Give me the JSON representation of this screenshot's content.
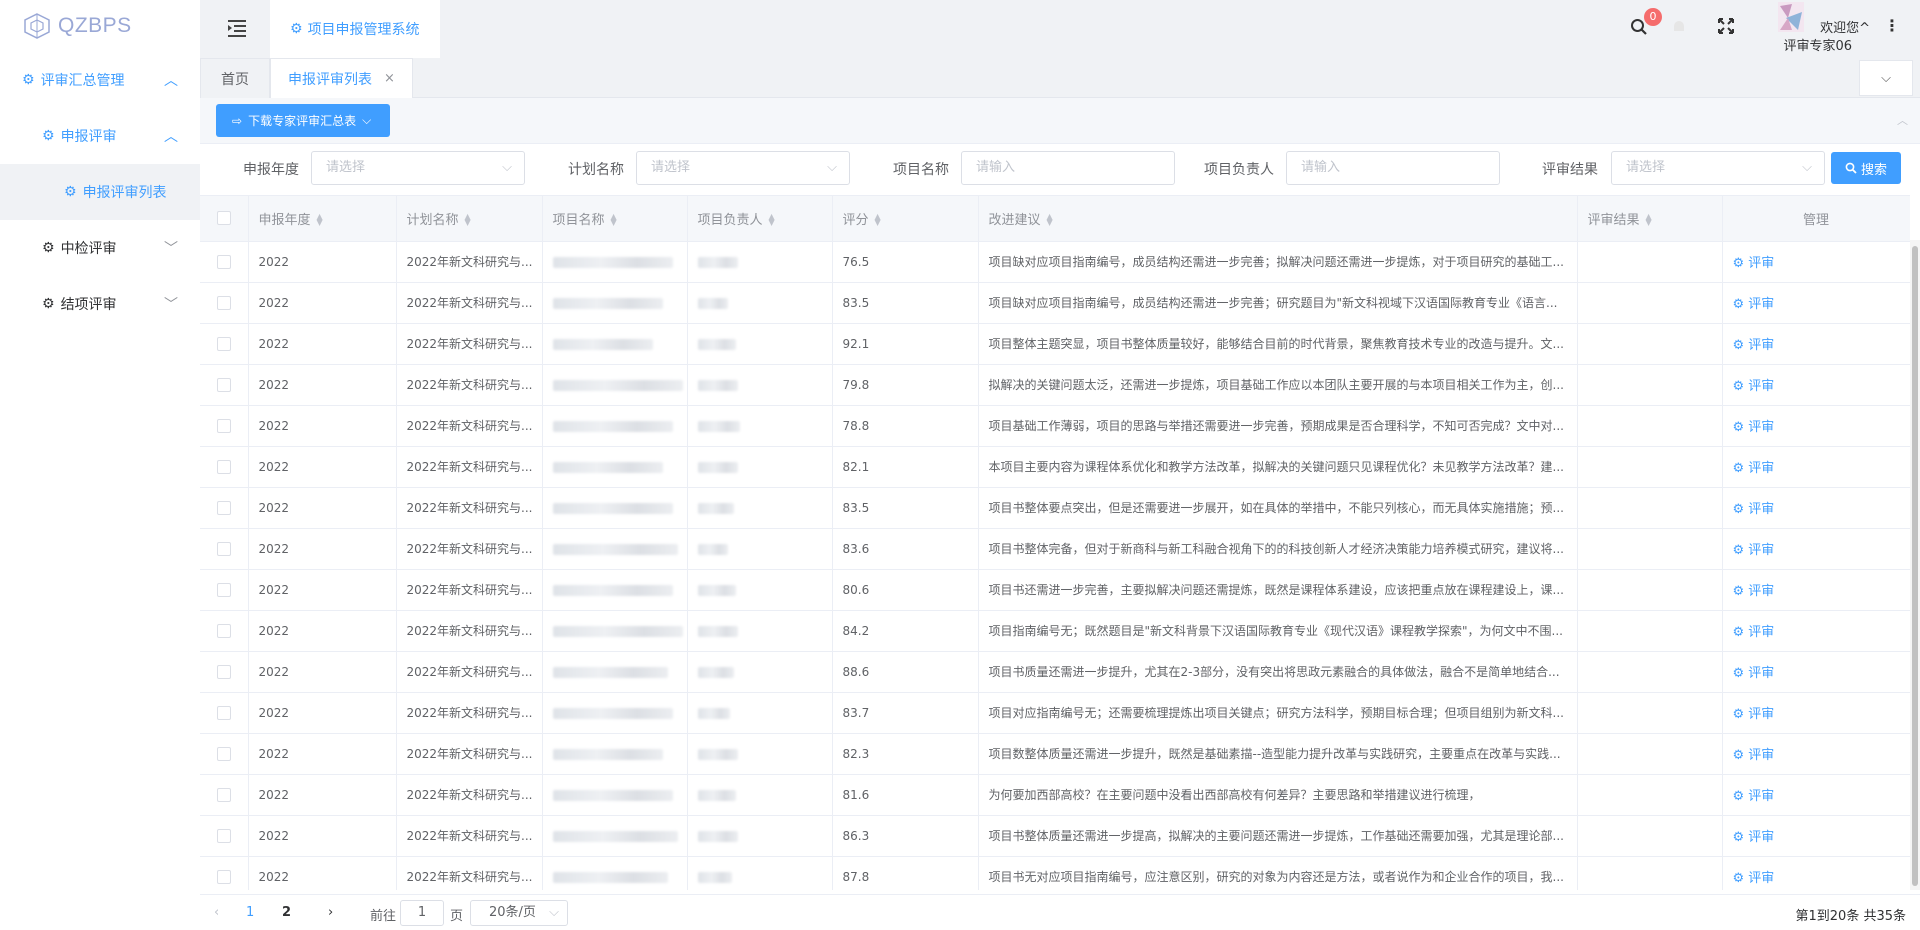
{
  "app": {
    "logo": "QZBPS",
    "system_tab": "项目申报管理系统"
  },
  "header": {
    "notification_count": "0",
    "welcome": "欢迎您^",
    "user_name": "评审专家06"
  },
  "sidebar": {
    "items": [
      {
        "label": "评审汇总管理",
        "level": 1
      },
      {
        "label": "申报评审",
        "level": 2
      },
      {
        "label": "申报评审列表",
        "level": 3
      },
      {
        "label": "中检评审",
        "level": 2
      },
      {
        "label": "结项评审",
        "level": 2
      }
    ]
  },
  "tabs": {
    "home": "首页",
    "active": "申报评审列表",
    "close": "×"
  },
  "toolbar": {
    "download_label": "下载专家评审汇总表"
  },
  "filters": {
    "year_label": "申报年度",
    "year_placeholder": "请选择",
    "plan_label": "计划名称",
    "plan_placeholder": "请选择",
    "project_label": "项目名称",
    "project_placeholder": "请输入",
    "leader_label": "项目负责人",
    "leader_placeholder": "请输入",
    "result_label": "评审结果",
    "result_placeholder": "请选择",
    "search_label": "搜索"
  },
  "table": {
    "columns": [
      "申报年度",
      "计划名称",
      "项目名称",
      "项目负责人",
      "评分",
      "改进建议",
      "评审结果",
      "管理"
    ],
    "action_label": "评审",
    "rows": [
      {
        "year": "2022",
        "plan": "2022年新文科研究与...",
        "score": "76.5",
        "suggestion": "项目缺对应项目指南编号，成员结构还需进一步完善；拟解决问题还需进一步提炼，对于项目研究的基础工...",
        "result": ""
      },
      {
        "year": "2022",
        "plan": "2022年新文科研究与...",
        "score": "83.5",
        "suggestion": "项目缺对应项目指南编号，成员结构还需进一步完善；研究题目为\"新文科视域下汉语国际教育专业《语言...",
        "result": ""
      },
      {
        "year": "2022",
        "plan": "2022年新文科研究与...",
        "score": "92.1",
        "suggestion": "项目整体主题突显，项目书整体质量较好，能够结合目前的时代背景，聚焦教育技术专业的改造与提升。文...",
        "result": ""
      },
      {
        "year": "2022",
        "plan": "2022年新文科研究与...",
        "score": "79.8",
        "suggestion": "拟解决的关键问题太泛，还需进一步提炼，项目基础工作应以本团队主要开展的与本项目相关工作为主，创...",
        "result": ""
      },
      {
        "year": "2022",
        "plan": "2022年新文科研究与...",
        "score": "78.8",
        "suggestion": "项目基础工作薄弱，项目的思路与举措还需要进一步完善，预期成果是否合理科学，不知可否完成？文中对...",
        "result": ""
      },
      {
        "year": "2022",
        "plan": "2022年新文科研究与...",
        "score": "82.1",
        "suggestion": "本项目主要内容为课程体系优化和教学方法改革，拟解决的关键问题只见课程优化？未见教学方法改革？建...",
        "result": ""
      },
      {
        "year": "2022",
        "plan": "2022年新文科研究与...",
        "score": "83.5",
        "suggestion": "项目书整体要点突出，但是还需要进一步展开，如在具体的举措中，不能只列核心，而无具体实施措施；预...",
        "result": ""
      },
      {
        "year": "2022",
        "plan": "2022年新文科研究与...",
        "score": "83.6",
        "suggestion": "项目书整体完备，但对于新商科与新工科融合视角下的的科技创新人才经济决策能力培养模式研究，建议将...",
        "result": ""
      },
      {
        "year": "2022",
        "plan": "2022年新文科研究与...",
        "score": "80.6",
        "suggestion": "项目书还需进一步完善，主要拟解决问题还需提炼，既然是课程体系建设，应该把重点放在课程建设上，课...",
        "result": ""
      },
      {
        "year": "2022",
        "plan": "2022年新文科研究与...",
        "score": "84.2",
        "suggestion": "项目指南编号无；既然题目是\"新文科背景下汉语国际教育专业《现代汉语》课程教学探索\"，为何文中不围...",
        "result": ""
      },
      {
        "year": "2022",
        "plan": "2022年新文科研究与...",
        "score": "88.6",
        "suggestion": "项目书质量还需进一步提升，尤其在2-3部分，没有突出将思政元素融合的具体做法，融合不是简单地结合...",
        "result": ""
      },
      {
        "year": "2022",
        "plan": "2022年新文科研究与...",
        "score": "83.7",
        "suggestion": "项目对应指南编号无；还需要梳理提炼出项目关键点；研究方法科学，预期目标合理；但项目组别为新文科...",
        "result": ""
      },
      {
        "year": "2022",
        "plan": "2022年新文科研究与...",
        "score": "82.3",
        "suggestion": "项目数整体质量还需进一步提升，既然是基础素描--造型能力提升改革与实践研究，主要重点在改革与实践...",
        "result": ""
      },
      {
        "year": "2022",
        "plan": "2022年新文科研究与...",
        "score": "81.6",
        "suggestion": "为何要加西部高校？在主要问题中没看出西部高校有何差异？主要思路和举措建议进行梳理，",
        "result": ""
      },
      {
        "year": "2022",
        "plan": "2022年新文科研究与...",
        "score": "86.3",
        "suggestion": "项目书整体质量还需进一步提高，拟解决的主要问题还需进一步提炼，工作基础还需要加强，尤其是理论部...",
        "result": ""
      },
      {
        "year": "2022",
        "plan": "2022年新文科研究与...",
        "score": "87.8",
        "suggestion": "项目书无对应项目指南编号，应注意区别，研究的对象为内容还是方法，或者说作为和企业合作的项目，我...",
        "result": ""
      }
    ]
  },
  "pagination": {
    "pages": [
      "1",
      "2"
    ],
    "goto_prefix": "前往",
    "goto_value": "1",
    "goto_suffix": "页",
    "page_size": "20条/页",
    "summary": "第1到20条 共35条"
  },
  "colors": {
    "accent": "#409eff",
    "badge": "#f56c6c",
    "bg": "#f0f2f5"
  }
}
